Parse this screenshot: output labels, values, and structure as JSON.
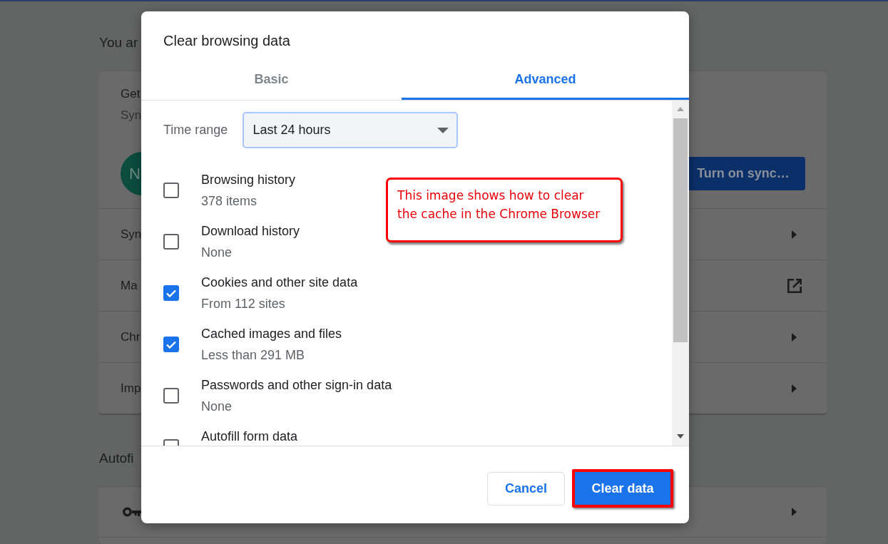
{
  "background_page": {
    "heading": "You ar",
    "account_card": {
      "title": "Get",
      "subtitle": "Syn",
      "avatar_initial": "N",
      "sync_button": "Turn on sync…",
      "rows": [
        {
          "label": "Syn",
          "kind": "arrow"
        },
        {
          "label": "Ma",
          "kind": "external"
        },
        {
          "label": "Chr",
          "kind": "arrow"
        },
        {
          "label": "Imp",
          "kind": "arrow"
        }
      ]
    },
    "autofill_heading": "Autofi",
    "autofill_card": {
      "rows": [
        {
          "kind": "key"
        }
      ]
    }
  },
  "dialog": {
    "title": "Clear browsing data",
    "tabs": [
      {
        "label": "Basic",
        "selected": false
      },
      {
        "label": "Advanced",
        "selected": true
      }
    ],
    "time_range": {
      "label": "Time range",
      "value": "Last 24 hours"
    },
    "items": [
      {
        "label": "Browsing history",
        "detail": "378 items",
        "checked": false
      },
      {
        "label": "Download history",
        "detail": "None",
        "checked": false
      },
      {
        "label": "Cookies and other site data",
        "detail": "From 112 sites",
        "checked": true
      },
      {
        "label": "Cached images and files",
        "detail": "Less than 291 MB",
        "checked": true
      },
      {
        "label": "Passwords and other sign-in data",
        "detail": "None",
        "checked": false
      },
      {
        "label": "Autofill form data",
        "checked": false
      }
    ],
    "buttons": [
      {
        "label": "Cancel",
        "kind": "secondary",
        "highlighted": false
      },
      {
        "label": "Clear data",
        "kind": "primary",
        "highlighted": true
      }
    ]
  },
  "annotation": {
    "lines": [
      "This image shows how to clear",
      "the cache in the Chrome Browser"
    ]
  }
}
